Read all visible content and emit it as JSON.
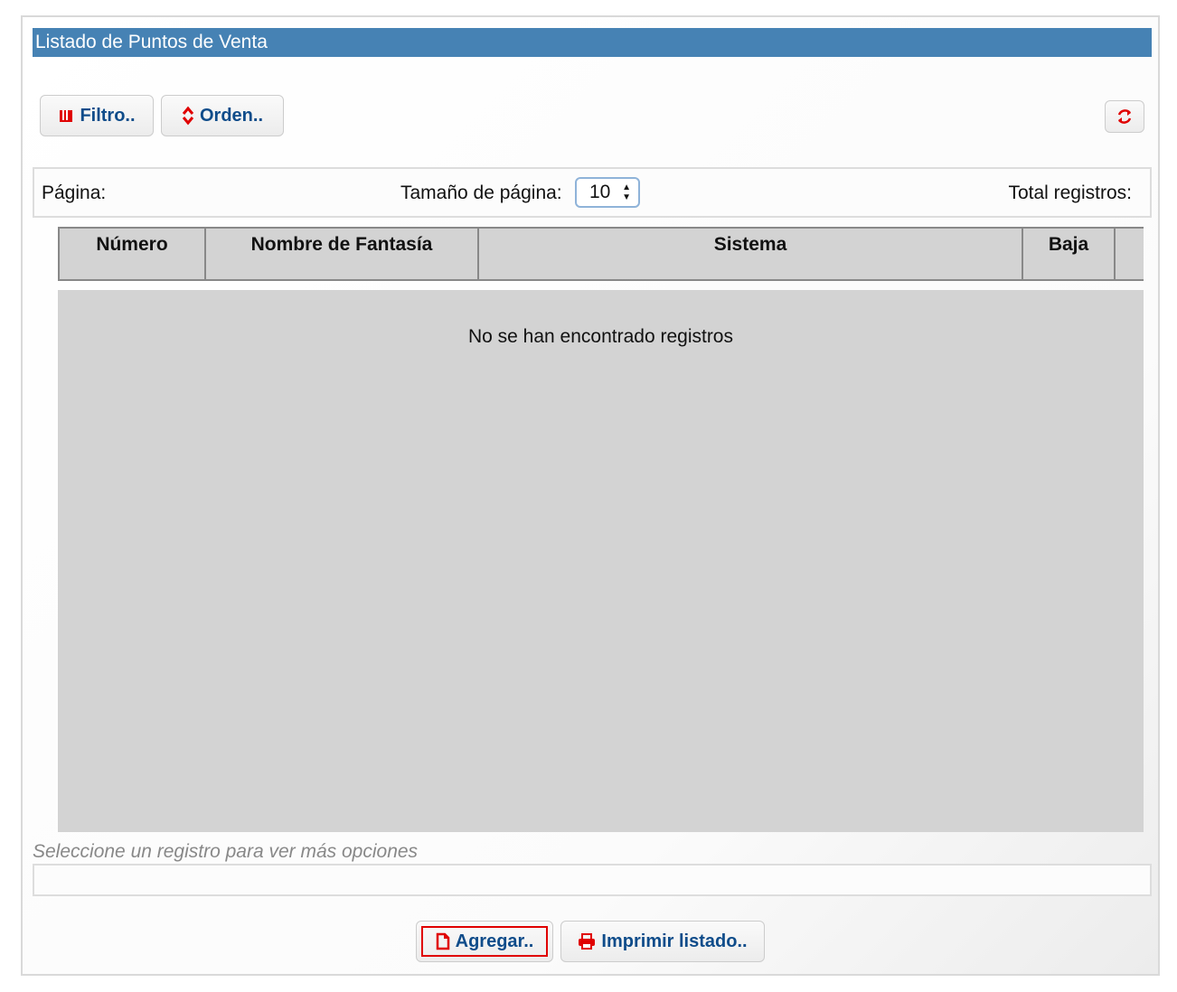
{
  "title": "Listado de Puntos de Venta",
  "toolbar": {
    "filter_label": "Filtro..",
    "order_label": "Orden..",
    "filter_icon": "book-icon",
    "order_icon": "sort-arrows-icon",
    "refresh_icon": "refresh-icon"
  },
  "pager": {
    "page_label": "Página:",
    "page_size_label": "Tamaño de página:",
    "page_size_value": "10",
    "total_label": "Total registros:"
  },
  "table": {
    "columns": [
      "Número",
      "Nombre de Fantasía",
      "Sistema",
      "Baja"
    ],
    "empty_message": "No se han encontrado registros"
  },
  "hint": "Seleccione un registro para ver más opciones",
  "actions": {
    "add_label": "Agregar..",
    "print_label": "Imprimir listado..",
    "add_icon": "document-icon",
    "print_icon": "printer-icon"
  },
  "colors": {
    "title_bar": "#4682b4",
    "button_text": "#0f4c8a",
    "icon_red": "#e00000",
    "grid_bg": "#d3d3d3"
  }
}
